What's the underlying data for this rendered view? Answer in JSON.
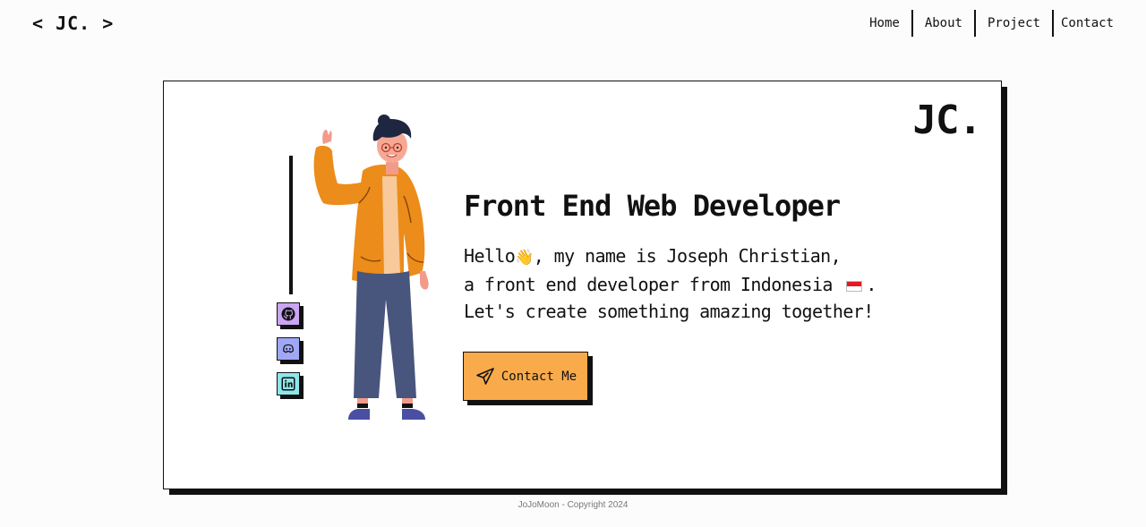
{
  "header": {
    "logo": "< JC. >",
    "nav": [
      "Home",
      "About",
      "Project",
      "Contact"
    ]
  },
  "card": {
    "mark": "JC.",
    "headline": "Front End Web Developer",
    "intro": {
      "line1_a": "Hello",
      "wave": "👋",
      "line1_b": ", my name is Joseph Christian,",
      "line2_a": "a front end developer from Indonesia",
      "line2_b": ".",
      "line3": "Let's create something amazing together!"
    },
    "cta_label": "Contact Me",
    "socials": [
      {
        "icon": "github-icon",
        "color": "#c9a6f2"
      },
      {
        "icon": "discord-icon",
        "color": "#a0a7f5"
      },
      {
        "icon": "linkedin-icon",
        "color": "#8ee6ea"
      }
    ]
  },
  "colors": {
    "accent": "#f9ab4b",
    "jacket": "#ec8c1a",
    "pants": "#48557d"
  },
  "footer": {
    "text": "JoJoMoon - Copyright 2024"
  }
}
